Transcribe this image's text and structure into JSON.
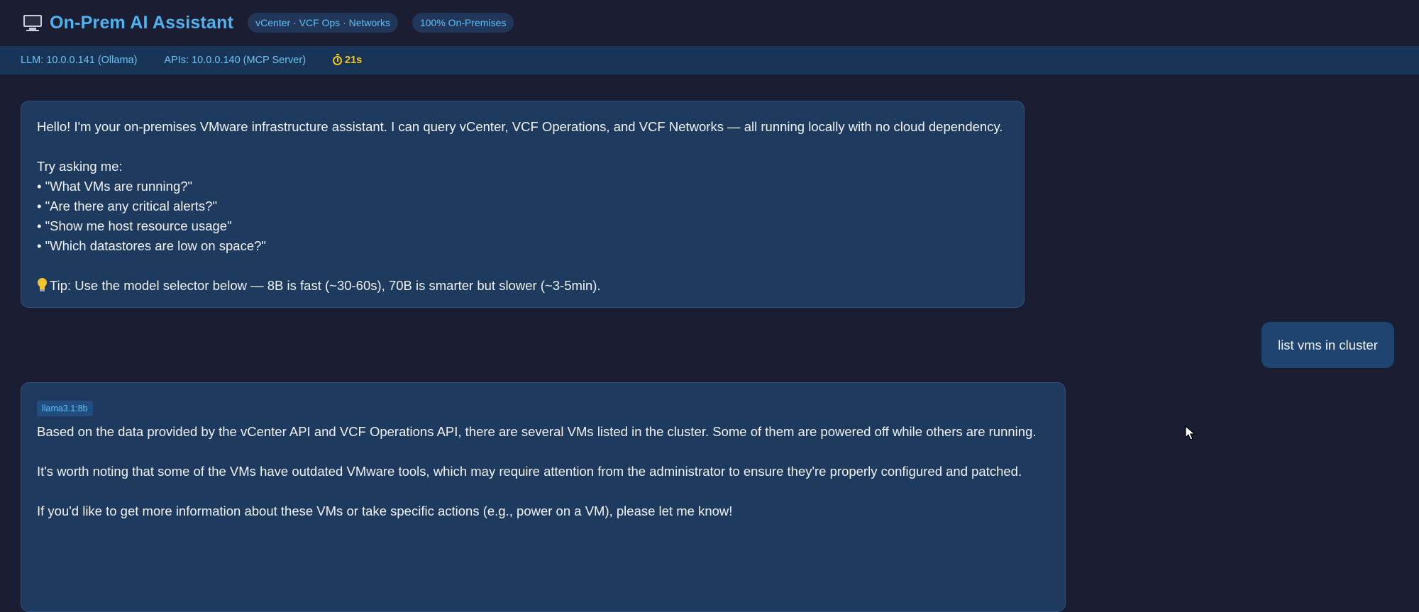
{
  "header": {
    "title": "On-Prem AI Assistant",
    "icon": "monitor-icon",
    "pills": [
      "vCenter · VCF Ops · Networks",
      "100% On-Premises"
    ]
  },
  "statusbar": {
    "llm": "LLM: 10.0.0.141 (Ollama)",
    "apis": "APIs: 10.0.0.140 (MCP Server)",
    "timer": "21s",
    "timer_icon": "stopwatch-icon"
  },
  "messages": {
    "welcome": {
      "intro": "Hello! I'm your on-premises VMware infrastructure assistant. I can query vCenter, VCF Operations, and VCF Networks — all running locally with no cloud dependency.",
      "try_heading": "Try asking me:",
      "suggestions": [
        "• \"What VMs are running?\"",
        "• \"Are there any critical alerts?\"",
        "• \"Show me host resource usage\"",
        "• \"Which datastores are low on space?\""
      ],
      "tip_icon": "lightbulb-icon",
      "tip": "Tip: Use the model selector below — 8B is fast (~30-60s), 70B is smarter but slower (~3-5min)."
    },
    "user": {
      "text": "list vms in cluster"
    },
    "reply": {
      "model": "llama3.1:8b",
      "paragraphs": [
        "Based on the data provided by the vCenter API and VCF Operations API, there are several VMs listed in the cluster. Some of them are powered off while others are running.",
        "It's worth noting that some of the VMs have outdated VMware tools, which may require attention from the administrator to ensure they're properly configured and patched.",
        "If you'd like to get more information about these VMs or take specific actions (e.g., power on a VM), please let me know!"
      ]
    }
  },
  "colors": {
    "background": "#1b1d33",
    "accent": "#4fb3f0",
    "bubble": "#1f3a5f",
    "timer": "#f5c518"
  }
}
